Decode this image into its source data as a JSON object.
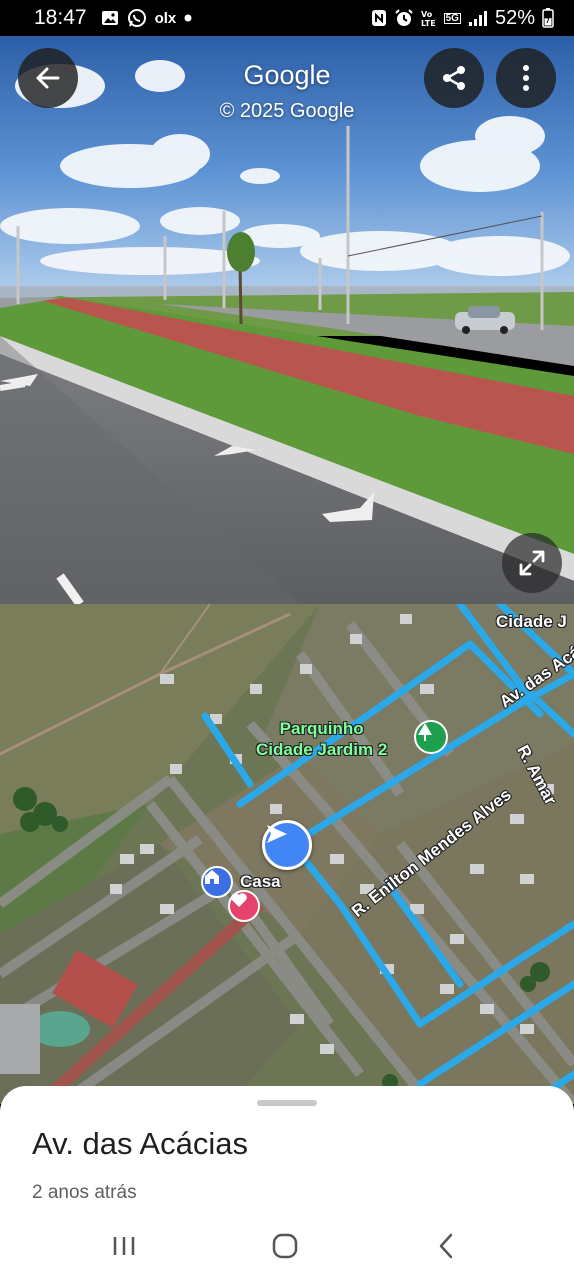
{
  "status_bar": {
    "time": "18:47",
    "battery": "52%",
    "network_badge": "5G",
    "left_icons": [
      "image-icon",
      "whatsapp-icon",
      "olx-icon",
      "dot-icon"
    ],
    "olx": "olx",
    "right_icons": [
      "nfc-icon",
      "alarm-icon",
      "volte-icon",
      "5g-icon",
      "signal-icon",
      "battery-icon"
    ]
  },
  "street_view": {
    "title": "Google",
    "copyright": "© 2025 Google",
    "buttons": [
      "back",
      "share",
      "more",
      "expand"
    ]
  },
  "map": {
    "labels": {
      "cidade_top": "Cidade J",
      "park_line1": "Parquinho",
      "park_line2": "Cidade Jardim 2",
      "av_acacias": "Av. das Acá",
      "r_amar": "R. Amar",
      "r_enilton": "R. Enilton Mendes Alves",
      "casa": "Casa"
    }
  },
  "sheet": {
    "title": "Av. das Acácias",
    "subtitle": "2 anos atrás"
  },
  "colors": {
    "route_blue": "#2aa8e8",
    "pin_blue": "#4285f4",
    "park_green": "#1e9e4f",
    "heart_pink": "#e5436b"
  }
}
